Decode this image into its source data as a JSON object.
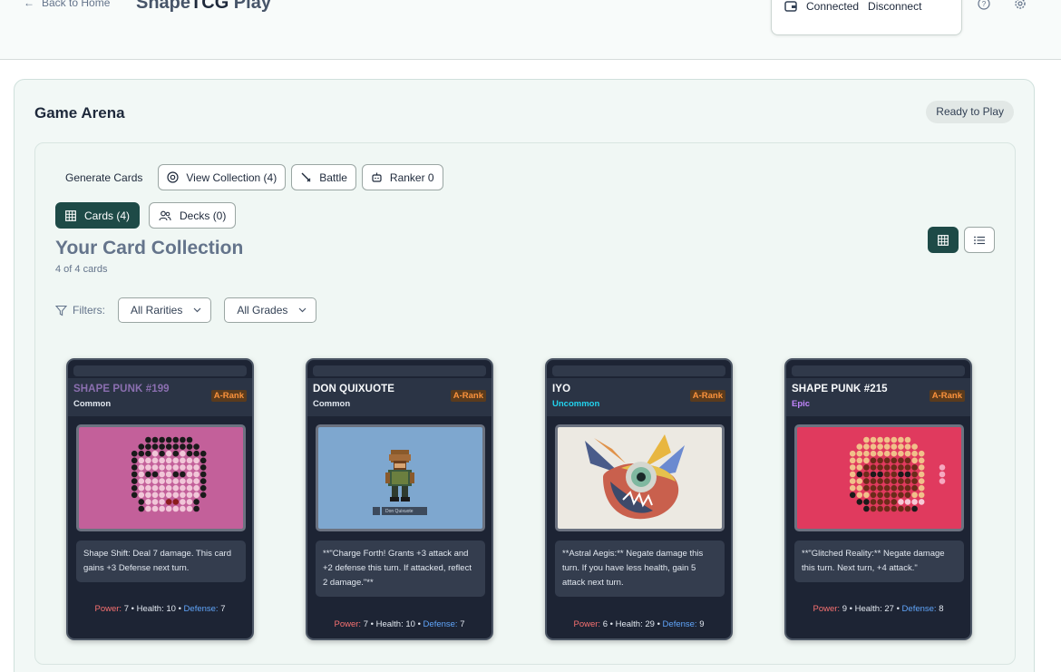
{
  "header": {
    "back_label": "Back to Home",
    "brand_prefix": "Shape",
    "brand_bold": "TCG",
    "brand_suffix": " Play",
    "wallet_status": "Connected",
    "disconnect_label": "Disconnect"
  },
  "arena": {
    "title": "Game Arena",
    "status": "Ready to Play"
  },
  "toolbar": {
    "generate_label": "Generate Cards",
    "view_collection_label": "View Collection (4)",
    "battle_label": "Battle",
    "ranker_label": "Ranker 0"
  },
  "tabs": {
    "cards_label": "Cards (4)",
    "decks_label": "Decks (0)"
  },
  "collection": {
    "title": "Your Card Collection",
    "count_text": "4 of 4 cards"
  },
  "filters": {
    "label": "Filters:",
    "rarity_value": "All Rarities",
    "grade_value": "All Grades"
  },
  "cards": [
    {
      "name": "SHAPE PUNK #199",
      "rarity": "Common",
      "rank": "A-Rank",
      "description": "Shape Shift: Deal 7 damage. This card gains +3 Defense next turn.",
      "power_label": "Power:",
      "power": "7",
      "health_label": "Health:",
      "health": "10",
      "defense_label": "Defense:",
      "defense": "7",
      "art_caption": ""
    },
    {
      "name": "DON QUIXUOTE",
      "rarity": "Common",
      "rank": "A-Rank",
      "description": "**\"Charge Forth! Grants +3 attack and +2 defense this turn. If attacked, reflect 2 damage.\"**",
      "power_label": "Power:",
      "power": "7",
      "health_label": "Health:",
      "health": "10",
      "defense_label": "Defense:",
      "defense": "7",
      "art_caption": "Don Quixuote"
    },
    {
      "name": "IYO",
      "rarity": "Uncommon",
      "rank": "A-Rank",
      "description": "**Astral Aegis:** Negate damage this turn. If you have less health, gain 5 attack next turn.",
      "power_label": "Power:",
      "power": "6",
      "health_label": "Health:",
      "health": "29",
      "defense_label": "Defense:",
      "defense": "9",
      "art_caption": ""
    },
    {
      "name": "SHAPE PUNK #215",
      "rarity": "Epic",
      "rank": "A-Rank",
      "description": "**\"Glitched Reality:** Negate damage this turn. Next turn, +4 attack.\"",
      "power_label": "Power:",
      "power": "9",
      "health_label": "Health:",
      "health": "27",
      "defense_label": "Defense:",
      "defense": "8",
      "art_caption": ""
    }
  ],
  "colors": {
    "accent_dark_teal": "#1e4a47",
    "card_bg": "#1d2434",
    "rank_orange": "#fb923c",
    "rarity_common": "#e2e8f0",
    "rarity_uncommon": "#22d3ee",
    "rarity_epic": "#c084fc",
    "name_purple": "#8b6fb0"
  }
}
